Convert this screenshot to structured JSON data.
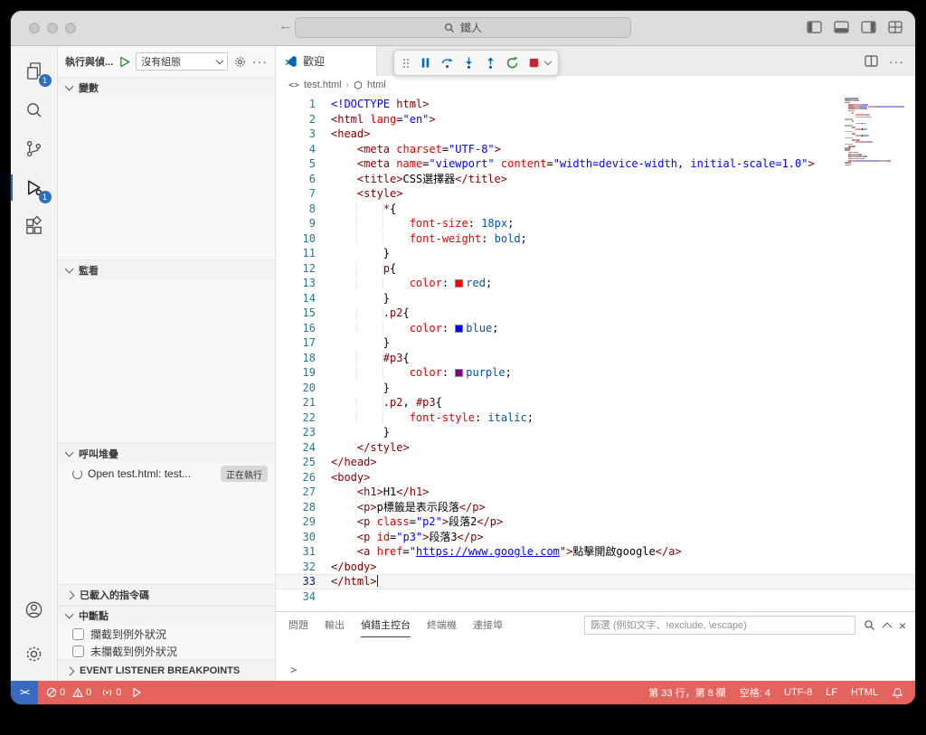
{
  "window": {
    "search_query": "鐵人",
    "nav_back": "←",
    "nav_forward": "→"
  },
  "activity_bar": {
    "explorer_badge": "1",
    "debug_badge": "1"
  },
  "sidebar": {
    "title": "執行與偵...",
    "config_dropdown": "沒有組態",
    "variables_label": "變數",
    "watch_label": "監看",
    "call_stack_label": "呼叫堆疊",
    "call_stack_item": "Open test.html: test...",
    "call_stack_state": "正在執行",
    "loaded_scripts_label": "已載入的指令碼",
    "breakpoints_label": "中斷點",
    "bp_caught": "攔截到例外狀況",
    "bp_uncaught": "未攔截到例外狀況",
    "event_listener_label": "EVENT LISTENER BREAKPOINTS"
  },
  "editor": {
    "tab_label": "歡迎",
    "breadcrumb_file": "test.html",
    "breadcrumb_symbol": "html",
    "current_line": 33,
    "cursor_col": 8,
    "lines": [
      [
        [
          "<!DOCTYPE ",
          "kw"
        ],
        [
          "html>",
          "tag"
        ]
      ],
      [
        [
          "<html ",
          "tag"
        ],
        [
          "lang",
          "attr"
        ],
        [
          "=",
          "pln"
        ],
        [
          "\"en\"",
          "str"
        ],
        [
          ">",
          "tag"
        ]
      ],
      [
        [
          "<head>",
          "tag"
        ]
      ],
      [
        [
          "    ",
          "pln"
        ],
        [
          "<meta ",
          "tag"
        ],
        [
          "charset",
          "attr"
        ],
        [
          "=",
          "pln"
        ],
        [
          "\"UTF-8\"",
          "str"
        ],
        [
          ">",
          "tag"
        ]
      ],
      [
        [
          "    ",
          "pln"
        ],
        [
          "<meta ",
          "tag"
        ],
        [
          "name",
          "attr"
        ],
        [
          "=",
          "pln"
        ],
        [
          "\"viewport\"",
          "str"
        ],
        [
          " ",
          "pln"
        ],
        [
          "content",
          "attr"
        ],
        [
          "=",
          "pln"
        ],
        [
          "\"width=device-width, initial-scale=1.0\"",
          "str"
        ],
        [
          ">",
          "tag"
        ]
      ],
      [
        [
          "    ",
          "pln"
        ],
        [
          "<title>",
          "tag"
        ],
        [
          "CSS選擇器",
          "pln"
        ],
        [
          "</title>",
          "tag"
        ]
      ],
      [
        [
          "    ",
          "pln"
        ],
        [
          "<style>",
          "tag"
        ]
      ],
      [
        [
          "        ",
          "pln"
        ],
        [
          "*",
          "sel"
        ],
        [
          "{",
          "pln"
        ]
      ],
      [
        [
          "            ",
          "pln"
        ],
        [
          "font-size",
          "prop"
        ],
        [
          ": ",
          "pln"
        ],
        [
          "18px",
          "val"
        ],
        [
          ";",
          "pln"
        ]
      ],
      [
        [
          "            ",
          "pln"
        ],
        [
          "font-weight",
          "prop"
        ],
        [
          ": ",
          "pln"
        ],
        [
          "bold",
          "val"
        ],
        [
          ";",
          "pln"
        ]
      ],
      [
        [
          "        }",
          "pln"
        ]
      ],
      [
        [
          "        ",
          "pln"
        ],
        [
          "p",
          "sel"
        ],
        [
          "{",
          "pln"
        ]
      ],
      [
        [
          "            ",
          "pln"
        ],
        [
          "color",
          "prop"
        ],
        [
          ": ",
          "pln"
        ],
        [
          "#ff0000",
          "sw"
        ],
        [
          "red",
          "val"
        ],
        [
          ";",
          "pln"
        ]
      ],
      [
        [
          "        }",
          "pln"
        ]
      ],
      [
        [
          "        ",
          "pln"
        ],
        [
          ".p2",
          "sel"
        ],
        [
          "{",
          "pln"
        ]
      ],
      [
        [
          "            ",
          "pln"
        ],
        [
          "color",
          "prop"
        ],
        [
          ": ",
          "pln"
        ],
        [
          "#0000ff",
          "sw"
        ],
        [
          "blue",
          "val"
        ],
        [
          ";",
          "pln"
        ]
      ],
      [
        [
          "        }",
          "pln"
        ]
      ],
      [
        [
          "        ",
          "pln"
        ],
        [
          "#p3",
          "sel"
        ],
        [
          "{",
          "pln"
        ]
      ],
      [
        [
          "            ",
          "pln"
        ],
        [
          "color",
          "prop"
        ],
        [
          ": ",
          "pln"
        ],
        [
          "#800080",
          "sw"
        ],
        [
          "purple",
          "val"
        ],
        [
          ";",
          "pln"
        ]
      ],
      [
        [
          "        }",
          "pln"
        ]
      ],
      [
        [
          "        ",
          "pln"
        ],
        [
          ".p2",
          "sel"
        ],
        [
          ", ",
          "pln"
        ],
        [
          "#p3",
          "sel"
        ],
        [
          "{",
          "pln"
        ]
      ],
      [
        [
          "            ",
          "pln"
        ],
        [
          "font-style",
          "prop"
        ],
        [
          ": ",
          "pln"
        ],
        [
          "italic",
          "val"
        ],
        [
          ";",
          "pln"
        ]
      ],
      [
        [
          "        }",
          "pln"
        ]
      ],
      [
        [
          "    ",
          "pln"
        ],
        [
          "</style>",
          "tag"
        ]
      ],
      [
        [
          "</head>",
          "tag"
        ]
      ],
      [
        [
          "<body>",
          "tag"
        ]
      ],
      [
        [
          "    ",
          "pln"
        ],
        [
          "<h1>",
          "tag"
        ],
        [
          "H1",
          "pln"
        ],
        [
          "</h1>",
          "tag"
        ]
      ],
      [
        [
          "    ",
          "pln"
        ],
        [
          "<p>",
          "tag"
        ],
        [
          "p標籤是表示段落",
          "pln"
        ],
        [
          "</p>",
          "tag"
        ]
      ],
      [
        [
          "    ",
          "pln"
        ],
        [
          "<p ",
          "tag"
        ],
        [
          "class",
          "attr"
        ],
        [
          "=",
          "pln"
        ],
        [
          "\"p2\"",
          "str"
        ],
        [
          ">",
          "tag"
        ],
        [
          "段落2",
          "pln"
        ],
        [
          "</p>",
          "tag"
        ]
      ],
      [
        [
          "    ",
          "pln"
        ],
        [
          "<p ",
          "tag"
        ],
        [
          "id",
          "attr"
        ],
        [
          "=",
          "pln"
        ],
        [
          "\"p3\"",
          "str"
        ],
        [
          ">",
          "tag"
        ],
        [
          "段落3",
          "pln"
        ],
        [
          "</p>",
          "tag"
        ]
      ],
      [
        [
          "    ",
          "pln"
        ],
        [
          "<a ",
          "tag"
        ],
        [
          "href",
          "attr"
        ],
        [
          "=",
          "pln"
        ],
        [
          "\"",
          "str"
        ],
        [
          "https://www.google.com",
          "link"
        ],
        [
          "\"",
          "str"
        ],
        [
          ">",
          "tag"
        ],
        [
          "點擊開啟google",
          "pln"
        ],
        [
          "</a>",
          "tag"
        ]
      ],
      [
        [
          "</body>",
          "tag"
        ]
      ],
      [
        [
          "</html>",
          "tag"
        ]
      ],
      []
    ]
  },
  "panel": {
    "tabs": [
      "問題",
      "輸出",
      "偵錯主控台",
      "終端機",
      "連接埠"
    ],
    "active_tab": "偵錯主控台",
    "filter_placeholder": "篩選 (例如文字、!exclude, \\escape)",
    "prompt": ">"
  },
  "status_bar": {
    "errors": "0",
    "warnings": "0",
    "ports": "0",
    "line_col": "第 33 行，第 8 欄",
    "indent": "空格: 4",
    "encoding": "UTF-8",
    "eol": "LF",
    "language": "HTML"
  },
  "icons": {
    "debug_toolbar": [
      "drag-handle",
      "pause",
      "step-over",
      "step-into",
      "step-out",
      "restart",
      "stop"
    ],
    "activity_bar": [
      "explorer",
      "search",
      "source-control",
      "run-and-debug",
      "extensions",
      "account",
      "settings"
    ],
    "panel_actions": [
      "filter",
      "search",
      "collapse",
      "close"
    ]
  },
  "colors": {
    "status_bar_bg": "#e4635f",
    "remote_bg": "#3a6bc2",
    "badge_bg": "#2f6fc0",
    "tag": "#800000",
    "attribute": "#e50000",
    "string": "#0000ff",
    "css_value": "#0451a5"
  }
}
